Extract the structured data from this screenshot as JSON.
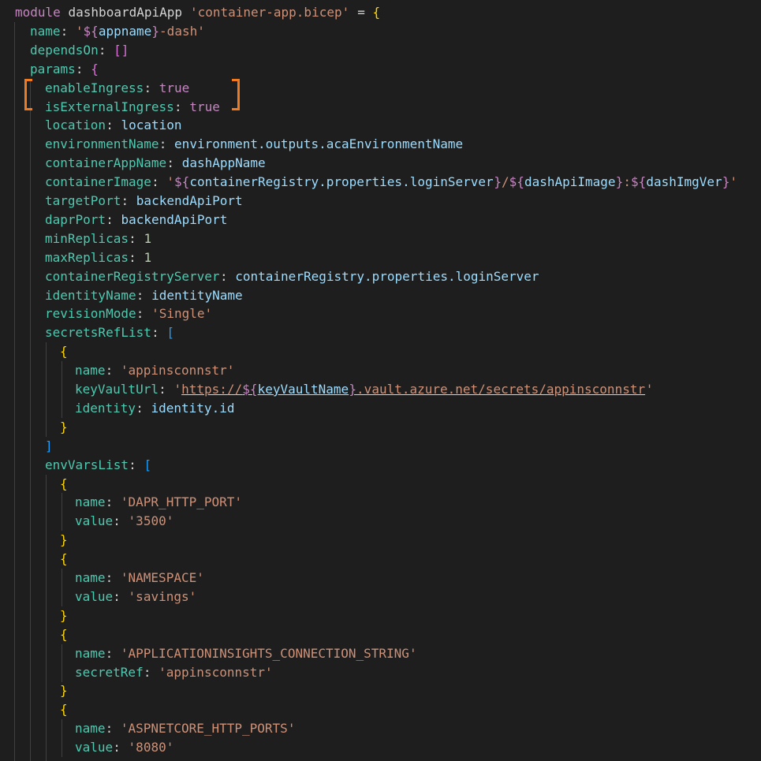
{
  "colors": {
    "background": "#1e1e1e",
    "keyword": "#c586c0",
    "identifier": "#d4d4d4",
    "property": "#4ec9b0",
    "variable": "#9cdcfe",
    "string": "#ce9178",
    "number": "#b5cea8",
    "boolean": "#569cd6",
    "bracket1": "#ffd700",
    "bracket2": "#da70d6",
    "bracket3": "#179fff",
    "annotation": "#f07a1f"
  },
  "icons": {
    "highlight": "orange-bracket-highlight-icon"
  },
  "code": {
    "lines": [
      {
        "indent": 0,
        "tokens": [
          {
            "t": "module",
            "c": "kw"
          },
          {
            "t": " dashboardApiApp ",
            "c": "id"
          },
          {
            "t": "'container-app.bicep'",
            "c": "str"
          },
          {
            "t": " = ",
            "c": "id"
          },
          {
            "t": "{",
            "c": "b1"
          }
        ]
      },
      {
        "indent": 1,
        "tokens": [
          {
            "t": "name",
            "c": "prop"
          },
          {
            "t": ": ",
            "c": "id"
          },
          {
            "t": "'",
            "c": "str"
          },
          {
            "t": "${",
            "c": "kw"
          },
          {
            "t": "appname",
            "c": "var"
          },
          {
            "t": "}",
            "c": "kw"
          },
          {
            "t": "-dash'",
            "c": "str"
          }
        ]
      },
      {
        "indent": 1,
        "tokens": [
          {
            "t": "dependsOn",
            "c": "prop"
          },
          {
            "t": ": ",
            "c": "id"
          },
          {
            "t": "[]",
            "c": "b2"
          }
        ]
      },
      {
        "indent": 1,
        "tokens": [
          {
            "t": "params",
            "c": "prop"
          },
          {
            "t": ": ",
            "c": "id"
          },
          {
            "t": "{",
            "c": "b2"
          }
        ]
      },
      {
        "indent": 2,
        "tokens": [
          {
            "t": "enableIngress",
            "c": "prop"
          },
          {
            "t": ": ",
            "c": "id"
          },
          {
            "t": "true",
            "c": "kw"
          }
        ]
      },
      {
        "indent": 2,
        "tokens": [
          {
            "t": "isExternalIngress",
            "c": "prop"
          },
          {
            "t": ": ",
            "c": "id"
          },
          {
            "t": "true",
            "c": "kw"
          }
        ]
      },
      {
        "indent": 2,
        "tokens": [
          {
            "t": "location",
            "c": "prop"
          },
          {
            "t": ": ",
            "c": "id"
          },
          {
            "t": "location",
            "c": "var"
          }
        ]
      },
      {
        "indent": 2,
        "tokens": [
          {
            "t": "environmentName",
            "c": "prop"
          },
          {
            "t": ": ",
            "c": "id"
          },
          {
            "t": "environment.outputs.acaEnvironmentName",
            "c": "var"
          }
        ]
      },
      {
        "indent": 2,
        "tokens": [
          {
            "t": "containerAppName",
            "c": "prop"
          },
          {
            "t": ": ",
            "c": "id"
          },
          {
            "t": "dashAppName",
            "c": "var"
          }
        ]
      },
      {
        "indent": 2,
        "tokens": [
          {
            "t": "containerImage",
            "c": "prop"
          },
          {
            "t": ": ",
            "c": "id"
          },
          {
            "t": "'",
            "c": "str"
          },
          {
            "t": "${",
            "c": "kw"
          },
          {
            "t": "containerRegistry.properties.loginServer",
            "c": "var"
          },
          {
            "t": "}",
            "c": "kw"
          },
          {
            "t": "/",
            "c": "str"
          },
          {
            "t": "${",
            "c": "kw"
          },
          {
            "t": "dashApiImage",
            "c": "var"
          },
          {
            "t": "}",
            "c": "kw"
          },
          {
            "t": ":",
            "c": "str"
          },
          {
            "t": "${",
            "c": "kw"
          },
          {
            "t": "dashImgVer",
            "c": "var"
          },
          {
            "t": "}",
            "c": "kw"
          },
          {
            "t": "'",
            "c": "str"
          }
        ]
      },
      {
        "indent": 2,
        "tokens": [
          {
            "t": "targetPort",
            "c": "prop"
          },
          {
            "t": ": ",
            "c": "id"
          },
          {
            "t": "backendApiPort",
            "c": "var"
          }
        ]
      },
      {
        "indent": 2,
        "tokens": [
          {
            "t": "daprPort",
            "c": "prop"
          },
          {
            "t": ": ",
            "c": "id"
          },
          {
            "t": "backendApiPort",
            "c": "var"
          }
        ]
      },
      {
        "indent": 2,
        "tokens": [
          {
            "t": "minReplicas",
            "c": "prop"
          },
          {
            "t": ": ",
            "c": "id"
          },
          {
            "t": "1",
            "c": "num"
          }
        ]
      },
      {
        "indent": 2,
        "tokens": [
          {
            "t": "maxReplicas",
            "c": "prop"
          },
          {
            "t": ": ",
            "c": "id"
          },
          {
            "t": "1",
            "c": "num"
          }
        ]
      },
      {
        "indent": 2,
        "tokens": [
          {
            "t": "containerRegistryServer",
            "c": "prop"
          },
          {
            "t": ": ",
            "c": "id"
          },
          {
            "t": "containerRegistry.properties.loginServer",
            "c": "var"
          }
        ]
      },
      {
        "indent": 2,
        "tokens": [
          {
            "t": "identityName",
            "c": "prop"
          },
          {
            "t": ": ",
            "c": "id"
          },
          {
            "t": "identityName",
            "c": "var"
          }
        ]
      },
      {
        "indent": 2,
        "tokens": [
          {
            "t": "revisionMode",
            "c": "prop"
          },
          {
            "t": ": ",
            "c": "id"
          },
          {
            "t": "'Single'",
            "c": "str"
          }
        ]
      },
      {
        "indent": 2,
        "tokens": [
          {
            "t": "secretsRefList",
            "c": "prop"
          },
          {
            "t": ": ",
            "c": "id"
          },
          {
            "t": "[",
            "c": "b3"
          }
        ]
      },
      {
        "indent": 3,
        "tokens": [
          {
            "t": "{",
            "c": "b1"
          }
        ]
      },
      {
        "indent": 4,
        "tokens": [
          {
            "t": "name",
            "c": "prop"
          },
          {
            "t": ": ",
            "c": "id"
          },
          {
            "t": "'appinsconnstr'",
            "c": "str"
          }
        ]
      },
      {
        "indent": 4,
        "tokens": [
          {
            "t": "keyVaultUrl",
            "c": "prop"
          },
          {
            "t": ": ",
            "c": "id"
          },
          {
            "t": "'",
            "c": "str"
          },
          {
            "t": "https://",
            "c": "str",
            "u": true
          },
          {
            "t": "${",
            "c": "kw",
            "u": true
          },
          {
            "t": "keyVaultName",
            "c": "var",
            "u": true
          },
          {
            "t": "}",
            "c": "kw",
            "u": true
          },
          {
            "t": ".vault.azure.net/secrets/appinsconnstr",
            "c": "str",
            "u": true
          },
          {
            "t": "'",
            "c": "str"
          }
        ]
      },
      {
        "indent": 4,
        "tokens": [
          {
            "t": "identity",
            "c": "prop"
          },
          {
            "t": ": ",
            "c": "id"
          },
          {
            "t": "identity.id",
            "c": "var"
          }
        ]
      },
      {
        "indent": 3,
        "tokens": [
          {
            "t": "}",
            "c": "b1"
          }
        ]
      },
      {
        "indent": 2,
        "tokens": [
          {
            "t": "]",
            "c": "b3"
          }
        ]
      },
      {
        "indent": 2,
        "tokens": [
          {
            "t": "envVarsList",
            "c": "prop"
          },
          {
            "t": ": ",
            "c": "id"
          },
          {
            "t": "[",
            "c": "b3"
          }
        ]
      },
      {
        "indent": 3,
        "tokens": [
          {
            "t": "{",
            "c": "b1"
          }
        ]
      },
      {
        "indent": 4,
        "tokens": [
          {
            "t": "name",
            "c": "prop"
          },
          {
            "t": ": ",
            "c": "id"
          },
          {
            "t": "'DAPR_HTTP_PORT'",
            "c": "str"
          }
        ]
      },
      {
        "indent": 4,
        "tokens": [
          {
            "t": "value",
            "c": "prop"
          },
          {
            "t": ": ",
            "c": "id"
          },
          {
            "t": "'3500'",
            "c": "str"
          }
        ]
      },
      {
        "indent": 3,
        "tokens": [
          {
            "t": "}",
            "c": "b1"
          }
        ]
      },
      {
        "indent": 3,
        "tokens": [
          {
            "t": "{",
            "c": "b1"
          }
        ]
      },
      {
        "indent": 4,
        "tokens": [
          {
            "t": "name",
            "c": "prop"
          },
          {
            "t": ": ",
            "c": "id"
          },
          {
            "t": "'NAMESPACE'",
            "c": "str"
          }
        ]
      },
      {
        "indent": 4,
        "tokens": [
          {
            "t": "value",
            "c": "prop"
          },
          {
            "t": ": ",
            "c": "id"
          },
          {
            "t": "'savings'",
            "c": "str"
          }
        ]
      },
      {
        "indent": 3,
        "tokens": [
          {
            "t": "}",
            "c": "b1"
          }
        ]
      },
      {
        "indent": 3,
        "tokens": [
          {
            "t": "{",
            "c": "b1"
          }
        ]
      },
      {
        "indent": 4,
        "tokens": [
          {
            "t": "name",
            "c": "prop"
          },
          {
            "t": ": ",
            "c": "id"
          },
          {
            "t": "'APPLICATIONINSIGHTS_CONNECTION_STRING'",
            "c": "str"
          }
        ]
      },
      {
        "indent": 4,
        "tokens": [
          {
            "t": "secretRef",
            "c": "prop"
          },
          {
            "t": ": ",
            "c": "id"
          },
          {
            "t": "'appinsconnstr'",
            "c": "str"
          }
        ]
      },
      {
        "indent": 3,
        "tokens": [
          {
            "t": "}",
            "c": "b1"
          }
        ]
      },
      {
        "indent": 3,
        "tokens": [
          {
            "t": "{",
            "c": "b1"
          }
        ]
      },
      {
        "indent": 4,
        "tokens": [
          {
            "t": "name",
            "c": "prop"
          },
          {
            "t": ": ",
            "c": "id"
          },
          {
            "t": "'ASPNETCORE_HTTP_PORTS'",
            "c": "str"
          }
        ]
      },
      {
        "indent": 4,
        "tokens": [
          {
            "t": "value",
            "c": "prop"
          },
          {
            "t": ": ",
            "c": "id"
          },
          {
            "t": "'8080'",
            "c": "str"
          }
        ]
      },
      {
        "indent": 3,
        "tokens": [
          {
            "t": "}",
            "c": "b1"
          }
        ]
      }
    ]
  }
}
